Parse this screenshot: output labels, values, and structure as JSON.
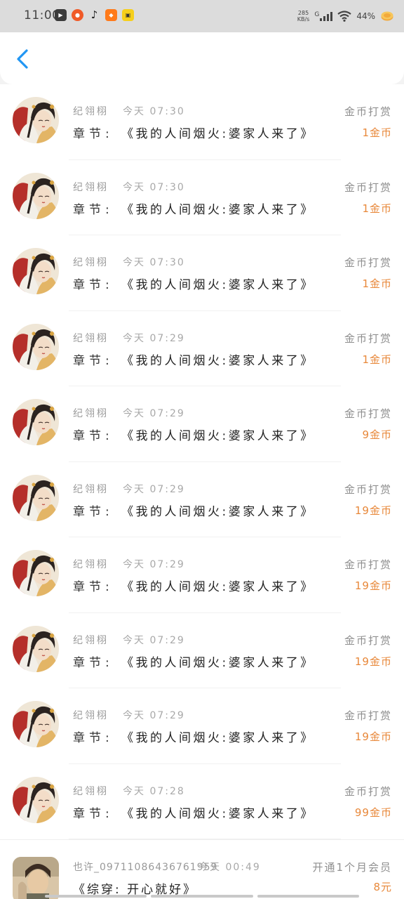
{
  "status_bar": {
    "time": "11:00",
    "net_speed_value": "285",
    "net_speed_unit": "KB/s",
    "network": "G",
    "battery": "44%",
    "app_icons": [
      {
        "name": "youku-app-icon",
        "color": "#3a3a3a"
      },
      {
        "name": "taobao-app-icon",
        "color": "#f05a28"
      },
      {
        "name": "tiktok-app-icon",
        "color": "#222222"
      },
      {
        "name": "app-icon-orange",
        "color": "#ff7a1a"
      },
      {
        "name": "app-icon-yellow",
        "color": "#f6cf1c"
      }
    ]
  },
  "header": {
    "back_icon": "chevron-left-icon",
    "accent": "#2196f3"
  },
  "labels": {
    "chapter": "章节:",
    "reward": "金币打赏",
    "coin_unit": "金币"
  },
  "rows": [
    {
      "user": "纪翎栩",
      "time": "今天 07:30",
      "chapter_title": "《我的人间烟火:婆家人来了》",
      "amount": "1"
    },
    {
      "user": "纪翎栩",
      "time": "今天 07:30",
      "chapter_title": "《我的人间烟火:婆家人来了》",
      "amount": "1"
    },
    {
      "user": "纪翎栩",
      "time": "今天 07:30",
      "chapter_title": "《我的人间烟火:婆家人来了》",
      "amount": "1"
    },
    {
      "user": "纪翎栩",
      "time": "今天 07:29",
      "chapter_title": "《我的人间烟火:婆家人来了》",
      "amount": "1"
    },
    {
      "user": "纪翎栩",
      "time": "今天 07:29",
      "chapter_title": "《我的人间烟火:婆家人来了》",
      "amount": "9"
    },
    {
      "user": "纪翎栩",
      "time": "今天 07:29",
      "chapter_title": "《我的人间烟火:婆家人来了》",
      "amount": "19"
    },
    {
      "user": "纪翎栩",
      "time": "今天 07:29",
      "chapter_title": "《我的人间烟火:婆家人来了》",
      "amount": "19"
    },
    {
      "user": "纪翎栩",
      "time": "今天 07:29",
      "chapter_title": "《我的人间烟火:婆家人来了》",
      "amount": "19"
    },
    {
      "user": "纪翎栩",
      "time": "今天 07:29",
      "chapter_title": "《我的人间烟火:婆家人来了》",
      "amount": "19"
    },
    {
      "user": "纪翎栩",
      "time": "今天 07:28",
      "chapter_title": "《我的人间烟火:婆家人来了》",
      "amount": "99"
    }
  ],
  "last_row": {
    "user": "也许_09711086436761959",
    "time": "今天 00:49",
    "chapter_title": "《综穿: 开心就好》",
    "label": "开通1个月会员",
    "amount": "8元"
  },
  "colors": {
    "coin": "#e8883a",
    "muted": "#9a9a9a"
  }
}
